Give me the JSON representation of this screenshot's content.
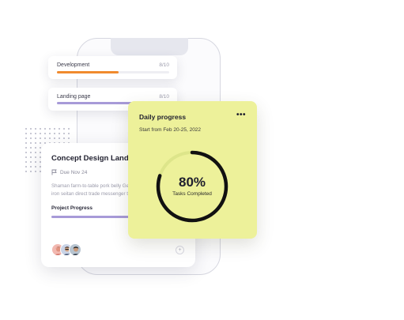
{
  "progress_cards": [
    {
      "label": "Development",
      "count": "8/10",
      "progress": 0.55
    },
    {
      "label": "Landing page",
      "count": "8/10",
      "progress": 0.74
    }
  ],
  "task_card": {
    "title": "Concept Design Landin",
    "due": "Due Nov 24",
    "description": "Shaman farm-to-table pork belly Gentrify dreamcatcher post-iron seitan direct trade messenger ta flexitarian enamel pin.",
    "progress_label": "Project Progress",
    "progress": 1.0,
    "add_icon": "plus-icon"
  },
  "daily": {
    "title": "Daily progress",
    "subtitle": "Start from Feb 20-25, 2022",
    "menu_icon": "more-dots-icon",
    "percent_text": "80%",
    "percent_value": 0.8,
    "caption": "Tasks Completed",
    "accent": "#111111",
    "ring_track": "#dde58a",
    "bg": "#edf19a"
  }
}
